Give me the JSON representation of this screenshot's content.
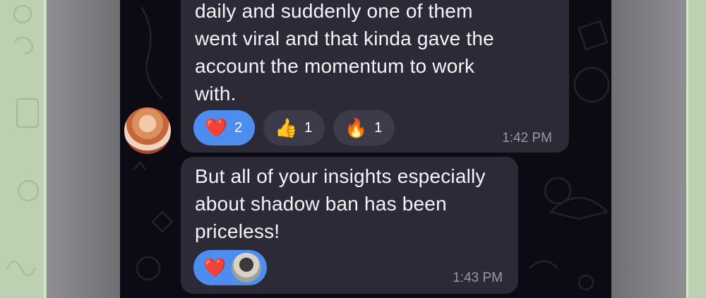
{
  "messages": [
    {
      "text": "daily and suddenly one of them\nwent viral and that kinda gave the\naccount the momentum to work\nwith.",
      "time": "1:42 PM",
      "reactions": [
        {
          "emoji": "❤️",
          "count": "2",
          "active": true
        },
        {
          "emoji": "👍",
          "count": "1",
          "active": false
        },
        {
          "emoji": "🔥",
          "count": "1",
          "active": false
        }
      ]
    },
    {
      "text": "But all of your insights especially\nabout shadow ban has been\npriceless!",
      "time": "1:43 PM",
      "reactions": [
        {
          "emoji": "❤️",
          "active": true
        }
      ]
    }
  ],
  "colors": {
    "chat_background": "#0c0a12",
    "bubble": "#2c2a37",
    "reaction_active": "#4d8df0",
    "reaction_inactive": "#3d3a4a",
    "timestamp": "#9b98a8"
  },
  "icons": [
    "heart-emoji",
    "thumbs-up-emoji",
    "fire-emoji",
    "sender-avatar",
    "reactor-avatar"
  ]
}
